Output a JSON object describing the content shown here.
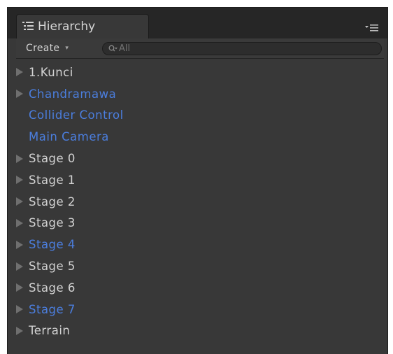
{
  "panel": {
    "tab_title": "Hierarchy",
    "tab_icon": "hierarchy-list-icon",
    "menu_icon": "panel-menu-icon"
  },
  "toolbar": {
    "create_label": "Create",
    "create_caret": "▾",
    "search_placeholder": "All",
    "search_value": ""
  },
  "colors": {
    "background": "#383838",
    "text": "#d2d2d2",
    "prefab_text": "#4b7ede",
    "arrow": "#6f6f6f"
  },
  "items": [
    {
      "label": "1.Kunci",
      "prefab": false,
      "has_children": true
    },
    {
      "label": "Chandramawa",
      "prefab": true,
      "has_children": true
    },
    {
      "label": "Collider Control",
      "prefab": true,
      "has_children": false
    },
    {
      "label": "Main Camera",
      "prefab": true,
      "has_children": false
    },
    {
      "label": "Stage 0",
      "prefab": false,
      "has_children": true
    },
    {
      "label": "Stage 1",
      "prefab": false,
      "has_children": true
    },
    {
      "label": "Stage 2",
      "prefab": false,
      "has_children": true
    },
    {
      "label": "Stage 3",
      "prefab": false,
      "has_children": true
    },
    {
      "label": "Stage 4",
      "prefab": true,
      "has_children": true
    },
    {
      "label": "Stage 5",
      "prefab": false,
      "has_children": true
    },
    {
      "label": "Stage 6",
      "prefab": false,
      "has_children": true
    },
    {
      "label": "Stage 7",
      "prefab": true,
      "has_children": true
    },
    {
      "label": "Terrain",
      "prefab": false,
      "has_children": true
    }
  ]
}
